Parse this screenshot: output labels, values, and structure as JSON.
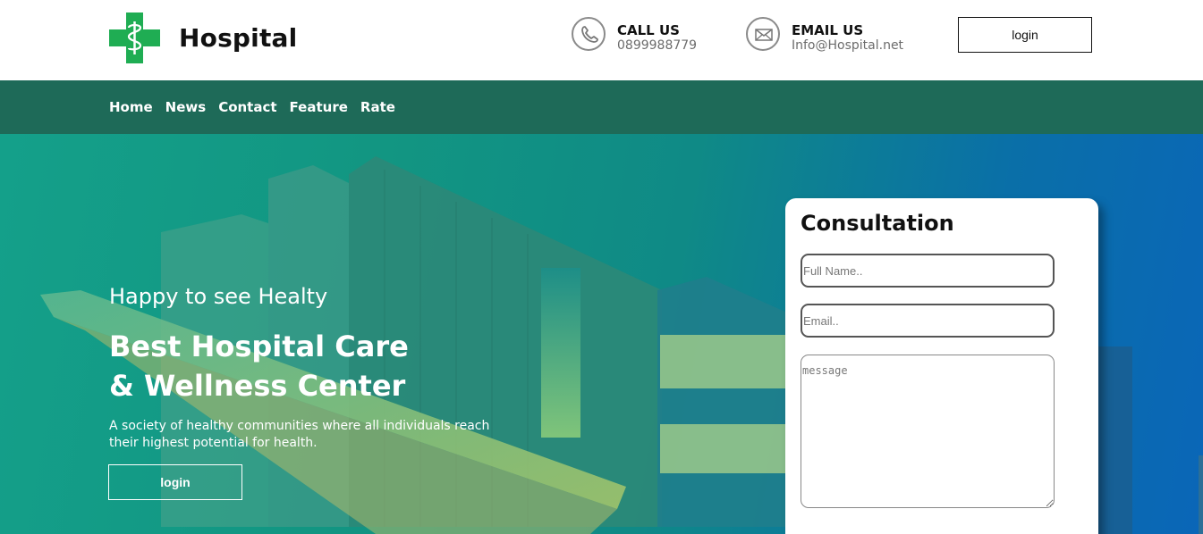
{
  "header": {
    "brand": "Hospital",
    "call": {
      "title": "CALL US",
      "value": "0899988779"
    },
    "email": {
      "title": "EMAIL US",
      "value": "Info@Hospital.net"
    },
    "login_label": "login"
  },
  "nav": {
    "items": [
      {
        "label": "Home"
      },
      {
        "label": "News"
      },
      {
        "label": "Contact"
      },
      {
        "label": "Feature"
      },
      {
        "label": "Rate"
      }
    ]
  },
  "hero": {
    "subtitle": "Happy to see Healty",
    "title_line1": "Best Hospital Care",
    "title_line2": "& Wellness Center",
    "description": "A society of healthy communities where all individuals reach their highest potential for health.",
    "login_label": "login"
  },
  "consultation": {
    "title": "Consultation",
    "name_placeholder": "Full Name..",
    "email_placeholder": "Email..",
    "message_placeholder": "message"
  },
  "colors": {
    "logo_green": "#1fad53",
    "nav_bg": "#1e6a58"
  }
}
